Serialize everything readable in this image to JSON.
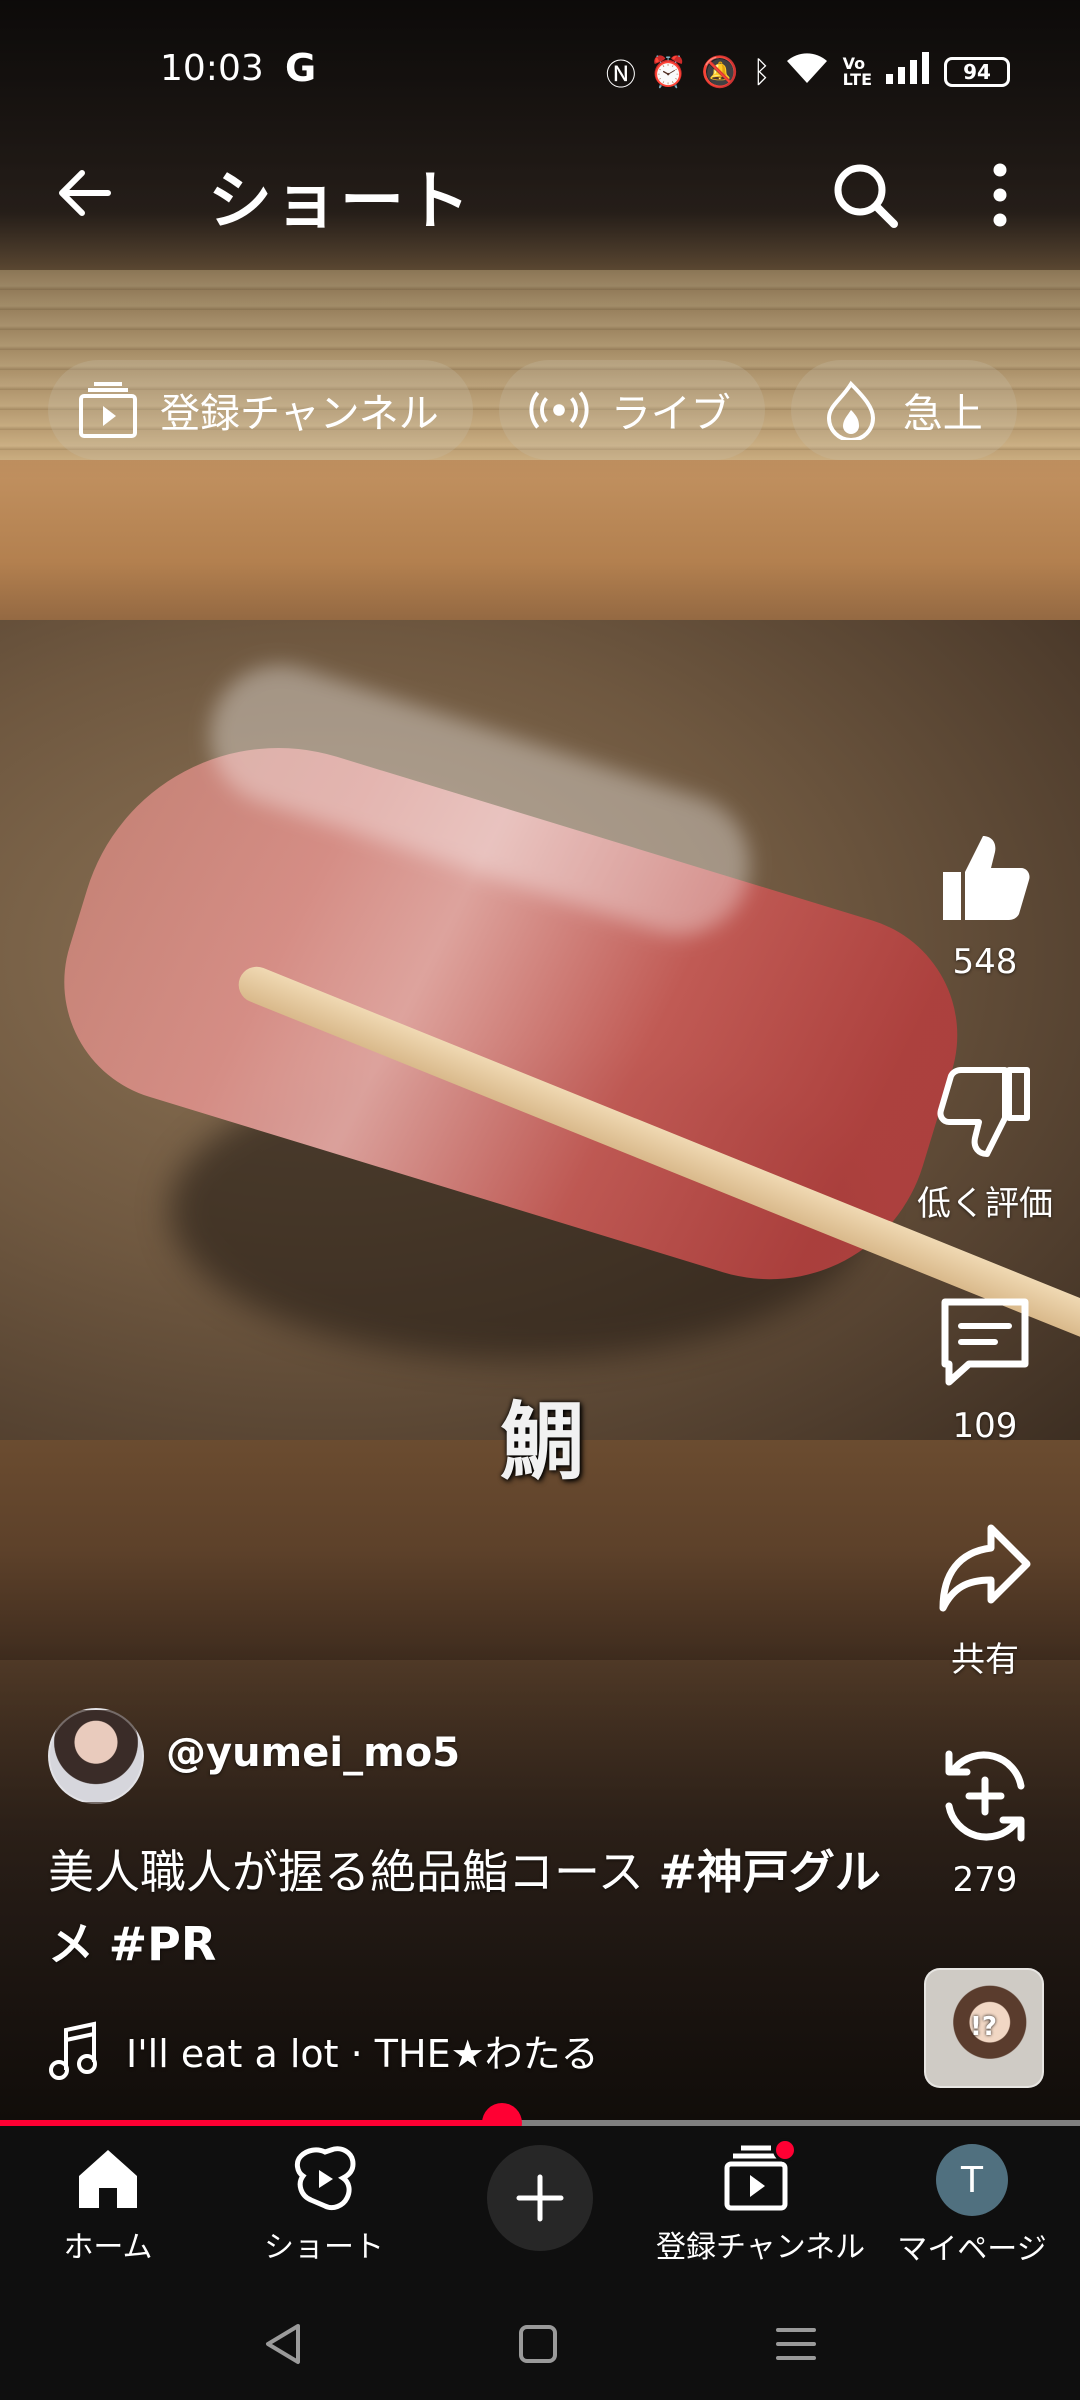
{
  "status_bar": {
    "time": "10:03",
    "carrier_icon": "G",
    "icons": [
      "nfc-icon",
      "alarm-icon",
      "mute-icon",
      "bluetooth-icon",
      "wifi-icon",
      "volte-icon",
      "signal-icon"
    ],
    "battery": "94"
  },
  "header": {
    "title": "ショート",
    "back_icon": "arrow-left-icon",
    "search_icon": "search-icon",
    "more_icon": "more-vert-icon"
  },
  "chips": [
    {
      "label": "登録チャンネル",
      "icon": "subscriptions-icon"
    },
    {
      "label": "ライブ",
      "icon": "live-icon"
    },
    {
      "label": "急上",
      "icon": "trending-icon"
    }
  ],
  "video": {
    "overlay_caption": "鯛"
  },
  "actions": {
    "like_count": "548",
    "dislike_label": "低く評価",
    "comment_count": "109",
    "share_label": "共有",
    "remix_count": "279"
  },
  "meta": {
    "handle": "@yumei_mo5",
    "description_plain": "美人職人が握る絶品鮨コース ",
    "hashtag1": "#神戸グルメ",
    "hashtag2": "#PR",
    "music": "I'll eat a lot · THE★わたる",
    "thumb_text": "!?"
  },
  "progress": {
    "played_fraction": 0.465
  },
  "bottom_nav": {
    "home": "ホーム",
    "shorts": "ショート",
    "subscriptions": "登録チャンネル",
    "profile": "マイページ",
    "avatar_letter": "T"
  },
  "colors": {
    "accent": "#ff0033",
    "nav_bg": "#0f0f0f",
    "avatar_bg": "#50707f"
  }
}
